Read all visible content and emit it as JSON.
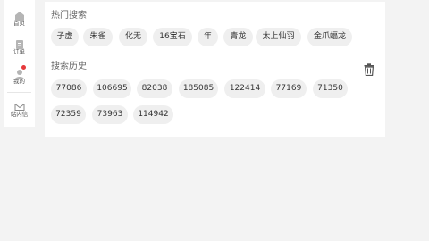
{
  "sidebar": {
    "items": [
      {
        "label": "首页",
        "icon": "home-icon"
      },
      {
        "label": "订单",
        "icon": "order-icon"
      },
      {
        "label": "我的",
        "icon": "user-icon",
        "badge_color": "#e6393b"
      },
      {
        "label": "站内信",
        "icon": "mail-icon"
      }
    ]
  },
  "hot_search": {
    "title": "热门搜索",
    "items": [
      "子虚",
      "朱雀",
      "化无",
      "16宝石",
      "年",
      "青龙",
      "太上仙羽",
      "金爪蝠龙"
    ]
  },
  "history": {
    "title": "搜索历史",
    "clear_icon": "trash-icon",
    "items": [
      "77086",
      "106695",
      "82038",
      "185085",
      "122414",
      "77169",
      "71350",
      "72359",
      "73963",
      "114942"
    ]
  },
  "colors": {
    "chip_bg": "#efefef",
    "page_bg": "#f3f3f3",
    "badge": "#e6393b"
  }
}
